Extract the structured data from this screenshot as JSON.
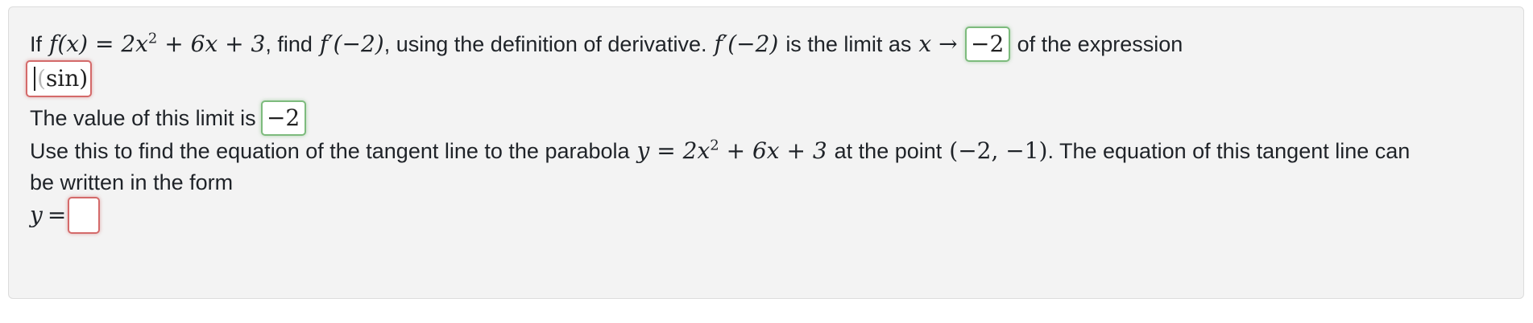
{
  "question": {
    "line1": {
      "prefix": "If",
      "fx_lhs": "f(x)",
      "eq": "=",
      "poly_a": "2x",
      "exp2": "2",
      "poly_rest": "+ 6x + 3",
      "find_text": ", find",
      "fprime_m2": "f′(−2)",
      "definition_text": ", using the definition of derivative.",
      "fprime_m2_b": "f′(−2)",
      "limit_text": "is the limit as",
      "x_var": "x",
      "arrow": "→",
      "limit_answer": "−2",
      "suffix": "of the expression"
    },
    "expression_answer": {
      "open_paren": "(",
      "content": "sin",
      "close_paren": ")"
    },
    "line3": {
      "text": "The value of this limit is",
      "answer": "−2"
    },
    "line4": {
      "text_a": "Use this to find the equation of the tangent line to the parabola",
      "y_var": "y",
      "eq": "=",
      "poly_a": "2x",
      "exp2": "2",
      "poly_rest": "+ 6x + 3",
      "point_text": "at the point",
      "point": "(−2, −1)",
      "text_b": ". The equation of this tangent line can"
    },
    "line5": {
      "text": "be written in the form"
    },
    "line6": {
      "y_var": "y",
      "eq": "=",
      "answer": ""
    }
  },
  "colors": {
    "card_bg": "#f3f3f3",
    "correct_border": "#7dbb7d",
    "incorrect_border": "#d46a6a"
  }
}
